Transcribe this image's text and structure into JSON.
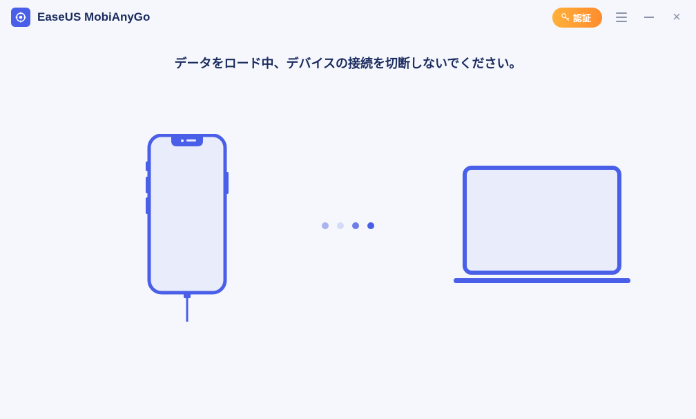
{
  "app": {
    "title": "EaseUS MobiAnyGo"
  },
  "titlebar": {
    "auth_label": "認証"
  },
  "main": {
    "status_message": "データをロード中、デバイスの接続を切断しないでください。"
  }
}
